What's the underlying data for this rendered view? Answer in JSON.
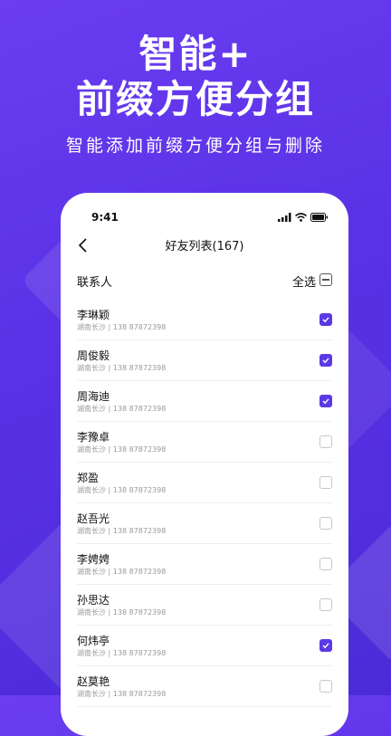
{
  "banner": {
    "line1": "智能+",
    "line2": "前缀方便分组",
    "subtitle": "智能添加前缀方便分组与删除"
  },
  "status_bar": {
    "time": "9:41",
    "icons": [
      "signal-icon",
      "wifi-icon",
      "battery-icon"
    ]
  },
  "nav": {
    "title": "好友列表(167)",
    "back_icon": "chevron-left-icon"
  },
  "toolbar": {
    "label": "联系人",
    "select_all": "全选"
  },
  "contacts": [
    {
      "name": "李琳颖",
      "detail": "湖南长沙 | 138 87872398",
      "checked": true
    },
    {
      "name": "周俊毅",
      "detail": "湖南长沙 | 138 87872398",
      "checked": true
    },
    {
      "name": "周海迪",
      "detail": "湖南长沙 | 138 87872398",
      "checked": true
    },
    {
      "name": "李豫卓",
      "detail": "湖南长沙 | 138 87872398",
      "checked": false
    },
    {
      "name": "郑盈",
      "detail": "湖南长沙 | 138 87872398",
      "checked": false
    },
    {
      "name": "赵吾光",
      "detail": "湖南长沙 | 138 87872398",
      "checked": false
    },
    {
      "name": "李娉娉",
      "detail": "湖南长沙 | 138 87872398",
      "checked": false
    },
    {
      "name": "孙思达",
      "detail": "湖南长沙 | 138 87872398",
      "checked": false
    },
    {
      "name": "何炜亭",
      "detail": "湖南长沙 | 138 87872398",
      "checked": true
    },
    {
      "name": "赵莫艳",
      "detail": "湖南长沙 | 138 87872398",
      "checked": false
    }
  ],
  "colors": {
    "accent": "#5b39e5",
    "background_top": "#6a3df0",
    "background_bottom": "#4b2bd8"
  }
}
